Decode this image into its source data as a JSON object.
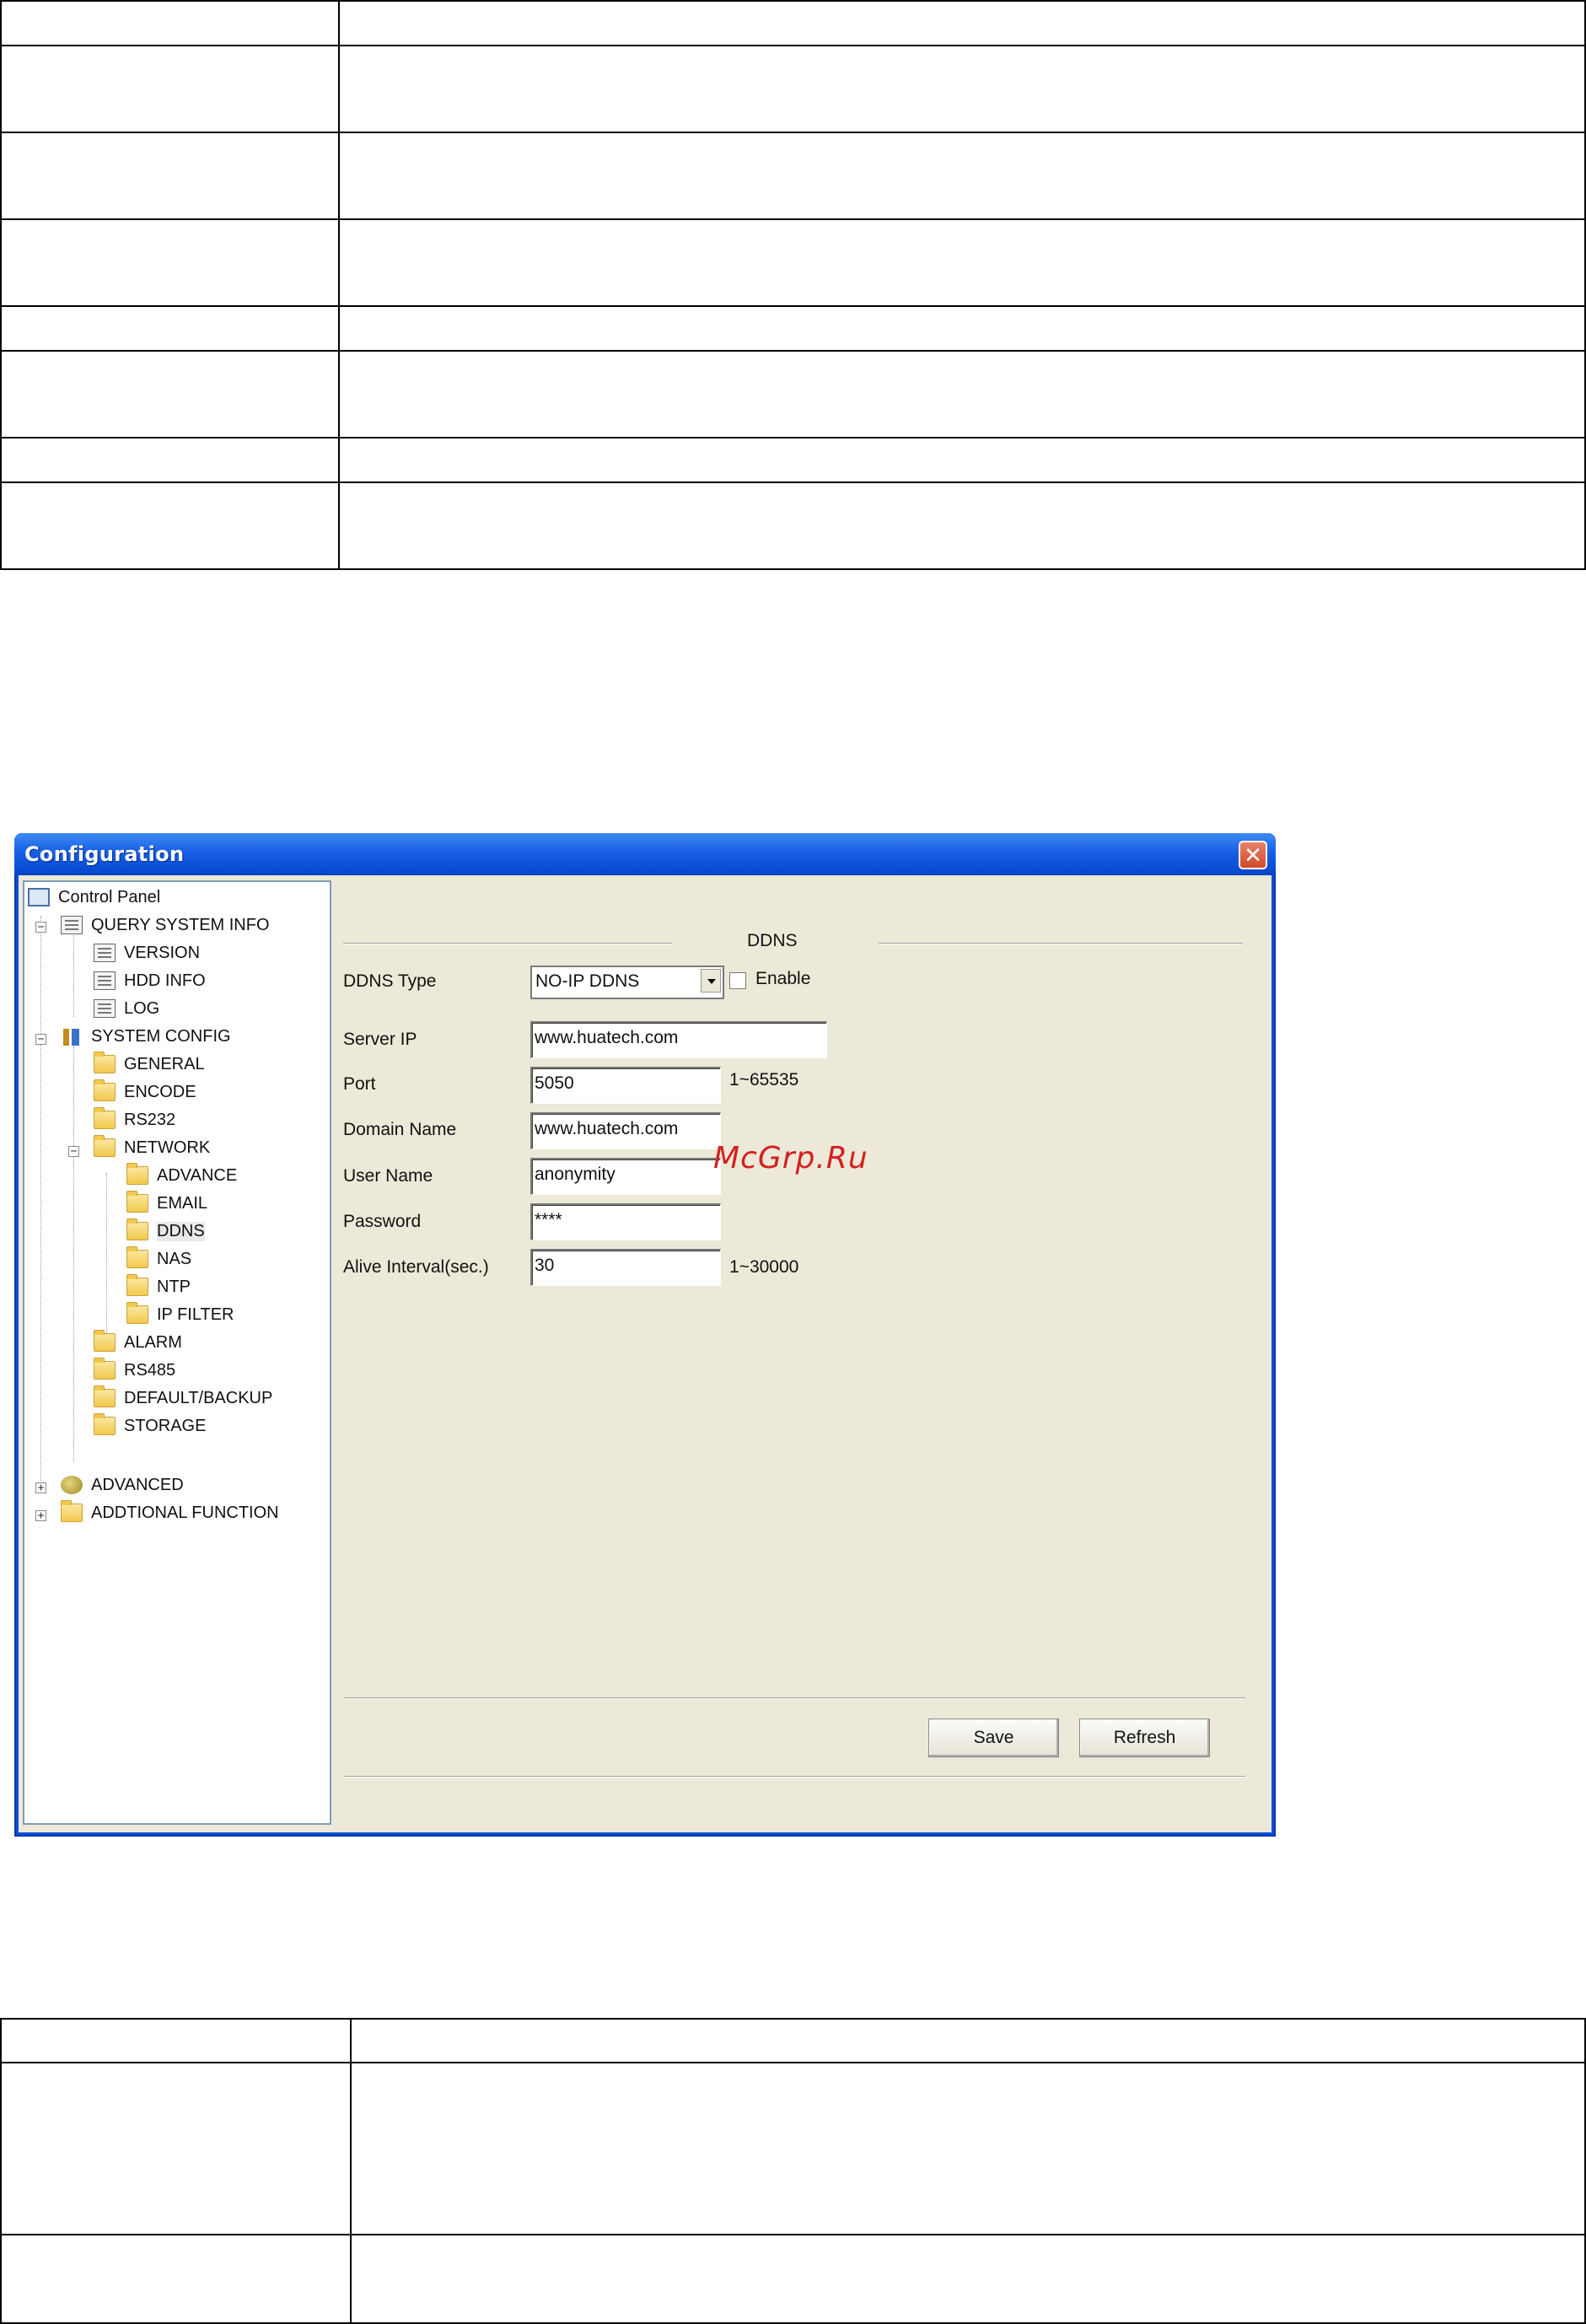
{
  "window": {
    "title": "Configuration",
    "close_glyph": "✕"
  },
  "tree": {
    "root": "Control Panel",
    "query_system_info": "QUERY SYSTEM INFO",
    "version": "VERSION",
    "hdd_info": "HDD INFO",
    "log": "LOG",
    "system_config": "SYSTEM CONFIG",
    "general": "GENERAL",
    "encode": "ENCODE",
    "rs232": "RS232",
    "network": "NETWORK",
    "advance": "ADVANCE",
    "email": "EMAIL",
    "ddns": "DDNS",
    "nas": "NAS",
    "ntp": "NTP",
    "ip_filter": "IP FILTER",
    "alarm": "ALARM",
    "rs485": "RS485",
    "default_backup": "DEFAULT/BACKUP",
    "storage": "STORAGE",
    "advanced": "ADVANCED",
    "additional_function": "ADDTIONAL FUNCTION",
    "expander_minus": "−",
    "expander_plus": "+"
  },
  "form": {
    "section_title": "DDNS",
    "ddns_type_label": "DDNS Type",
    "ddns_type_value": "NO-IP DDNS",
    "enable_label": "Enable",
    "enable_checked": false,
    "server_ip_label": "Server IP",
    "server_ip_value": "www.huatech.com",
    "port_label": "Port",
    "port_value": "5050",
    "port_range": "1~65535",
    "domain_name_label": "Domain Name",
    "domain_name_value": "www.huatech.com",
    "user_name_label": "User Name",
    "user_name_value": "anonymity",
    "password_label": "Password",
    "password_value": "****",
    "alive_interval_label": "Alive Interval(sec.)",
    "alive_interval_value": "30",
    "alive_interval_range": "1~30000",
    "save_label": "Save",
    "refresh_label": "Refresh"
  },
  "watermark": "McGrp.Ru"
}
